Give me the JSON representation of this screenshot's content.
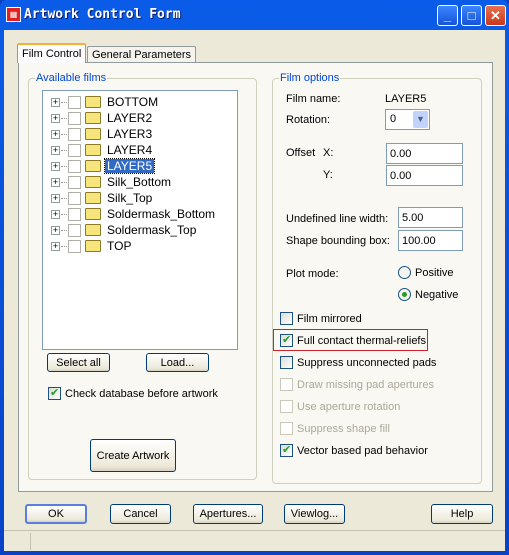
{
  "window": {
    "title": "Artwork Control Form",
    "controls": [
      "minimize",
      "maximize",
      "close"
    ]
  },
  "tabs": [
    {
      "label": "Film Control",
      "active": true
    },
    {
      "label": "General Parameters",
      "active": false
    }
  ],
  "available_films": {
    "legend": "Available films",
    "items": [
      {
        "label": "BOTTOM",
        "checked": false,
        "selected": false
      },
      {
        "label": "LAYER2",
        "checked": false,
        "selected": false
      },
      {
        "label": "LAYER3",
        "checked": false,
        "selected": false
      },
      {
        "label": "LAYER4",
        "checked": false,
        "selected": false
      },
      {
        "label": "LAYER5",
        "checked": false,
        "selected": true
      },
      {
        "label": "Silk_Bottom",
        "checked": false,
        "selected": false
      },
      {
        "label": "Silk_Top",
        "checked": false,
        "selected": false
      },
      {
        "label": "Soldermask_Bottom",
        "checked": false,
        "selected": false
      },
      {
        "label": "Soldermask_Top",
        "checked": false,
        "selected": false
      },
      {
        "label": "TOP",
        "checked": false,
        "selected": false
      }
    ],
    "select_all": "Select all",
    "load": "Load...",
    "check_db": {
      "label": "Check database before artwork",
      "checked": true
    },
    "create": "Create Artwork"
  },
  "film_options": {
    "legend": "Film options",
    "film_name_label": "Film name:",
    "film_name": "LAYER5",
    "rotation_label": "Rotation:",
    "rotation": "0",
    "offset_label": "Offset",
    "x_label": "X:",
    "x": "0.00",
    "y_label": "Y:",
    "y": "0.00",
    "undef_label": "Undefined line width:",
    "undef": "5.00",
    "shape_label": "Shape bounding box:",
    "shape": "100.00",
    "plot_label": "Plot mode:",
    "positive": "Positive",
    "negative": "Negative",
    "plot_mode": "Negative",
    "checks": [
      {
        "label": "Film mirrored",
        "checked": false,
        "enabled": true
      },
      {
        "label": "Full contact thermal-reliefs",
        "checked": true,
        "enabled": true,
        "highlighted": true
      },
      {
        "label": "Suppress unconnected pads",
        "checked": false,
        "enabled": true
      },
      {
        "label": "Draw missing pad apertures",
        "checked": false,
        "enabled": false
      },
      {
        "label": "Use aperture rotation",
        "checked": false,
        "enabled": false
      },
      {
        "label": "Suppress shape fill",
        "checked": false,
        "enabled": false
      },
      {
        "label": "Vector based pad behavior",
        "checked": true,
        "enabled": true
      }
    ]
  },
  "buttons": {
    "ok": "OK",
    "cancel": "Cancel",
    "apertures": "Apertures...",
    "viewlog": "Viewlog...",
    "help": "Help"
  },
  "colors": {
    "highlight": "#d0242b",
    "accent": "#0046d5"
  }
}
